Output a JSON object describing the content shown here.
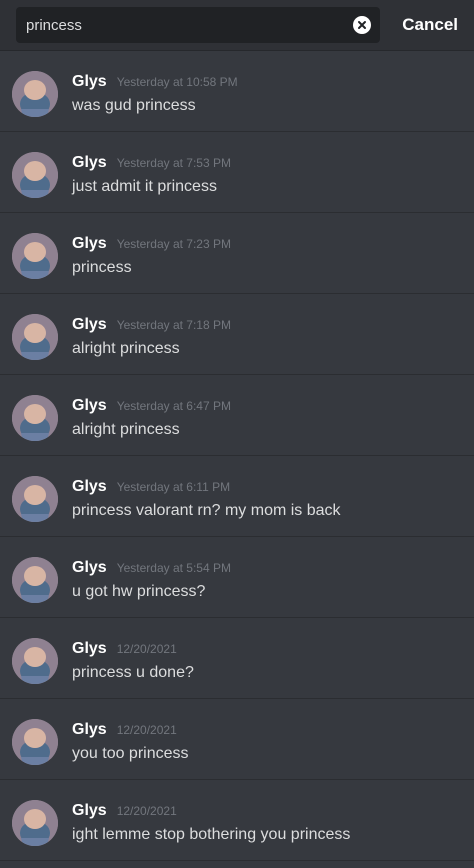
{
  "search": {
    "query": "princess",
    "cancel_label": "Cancel"
  },
  "icons": {
    "clear": "clear-x-circle-icon",
    "avatar": "user-avatar"
  },
  "colors": {
    "background": "#36393f",
    "search_bar": "#2f3136",
    "search_field": "#202225",
    "username": "#ffffff",
    "timestamp": "#72767d",
    "message_text": "#dcddde"
  },
  "messages": [
    {
      "author": "Glys",
      "timestamp": "Yesterday at 10:58 PM",
      "text": "was gud princess"
    },
    {
      "author": "Glys",
      "timestamp": "Yesterday at 7:53 PM",
      "text": "just admit it princess"
    },
    {
      "author": "Glys",
      "timestamp": "Yesterday at 7:23 PM",
      "text": "princess"
    },
    {
      "author": "Glys",
      "timestamp": "Yesterday at 7:18 PM",
      "text": "alright princess"
    },
    {
      "author": "Glys",
      "timestamp": "Yesterday at 6:47 PM",
      "text": "alright princess"
    },
    {
      "author": "Glys",
      "timestamp": "Yesterday at 6:11 PM",
      "text": "princess valorant rn? my mom is back"
    },
    {
      "author": "Glys",
      "timestamp": "Yesterday at 5:54 PM",
      "text": "u got hw princess?"
    },
    {
      "author": "Glys",
      "timestamp": "12/20/2021",
      "text": "princess u done?"
    },
    {
      "author": "Glys",
      "timestamp": "12/20/2021",
      "text": "you too princess"
    },
    {
      "author": "Glys",
      "timestamp": "12/20/2021",
      "text": "ight lemme stop bothering you princess"
    }
  ]
}
